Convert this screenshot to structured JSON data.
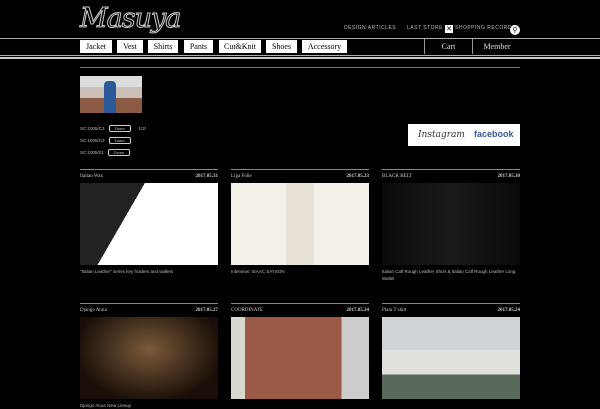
{
  "header": {
    "logo": "Masuya",
    "links": [
      "DESIGN ARTICLES",
      "LAST STORE",
      "SHOPPING RECORDS"
    ]
  },
  "nav": {
    "items": [
      "Jacket",
      "Vest",
      "Shirts",
      "Pants",
      "Cut&Knit",
      "Shoes",
      "Accessory"
    ],
    "cart": "Cart",
    "member": "Member"
  },
  "info": {
    "rows": [
      {
        "label": "SC:1005/C3",
        "button": "Zoom"
      },
      {
        "label": "SC:1005/C3",
        "button": "Zoom"
      },
      {
        "label": "SC:1005/01",
        "button": "Zoom"
      }
    ],
    "extra": "1/2/"
  },
  "sns": {
    "instagram": "Instagram",
    "facebook": "facebook"
  },
  "cards": [
    {
      "title": "Italian Wax",
      "date": "2017.05.31",
      "text": "\"Italian Leather\" series key holders and wallets"
    },
    {
      "title": "Liga Folle",
      "date": "2017.05.23",
      "text": "Interview: ISAAC SAYSON"
    },
    {
      "title": "BLACK BELT",
      "date": "2017.05.30",
      "text": "Italian Calf Rough Leather Short & Italian Calf Rough Leather Long Wallet"
    },
    {
      "title": "Django Atour",
      "date": "2017.05.27",
      "text": "Django Atour New Lineup"
    },
    {
      "title": "COORDINATE",
      "date": "2017.05.24",
      "text": ""
    },
    {
      "title": "Plain T shirt",
      "date": "2017.05.24",
      "text": ""
    }
  ]
}
